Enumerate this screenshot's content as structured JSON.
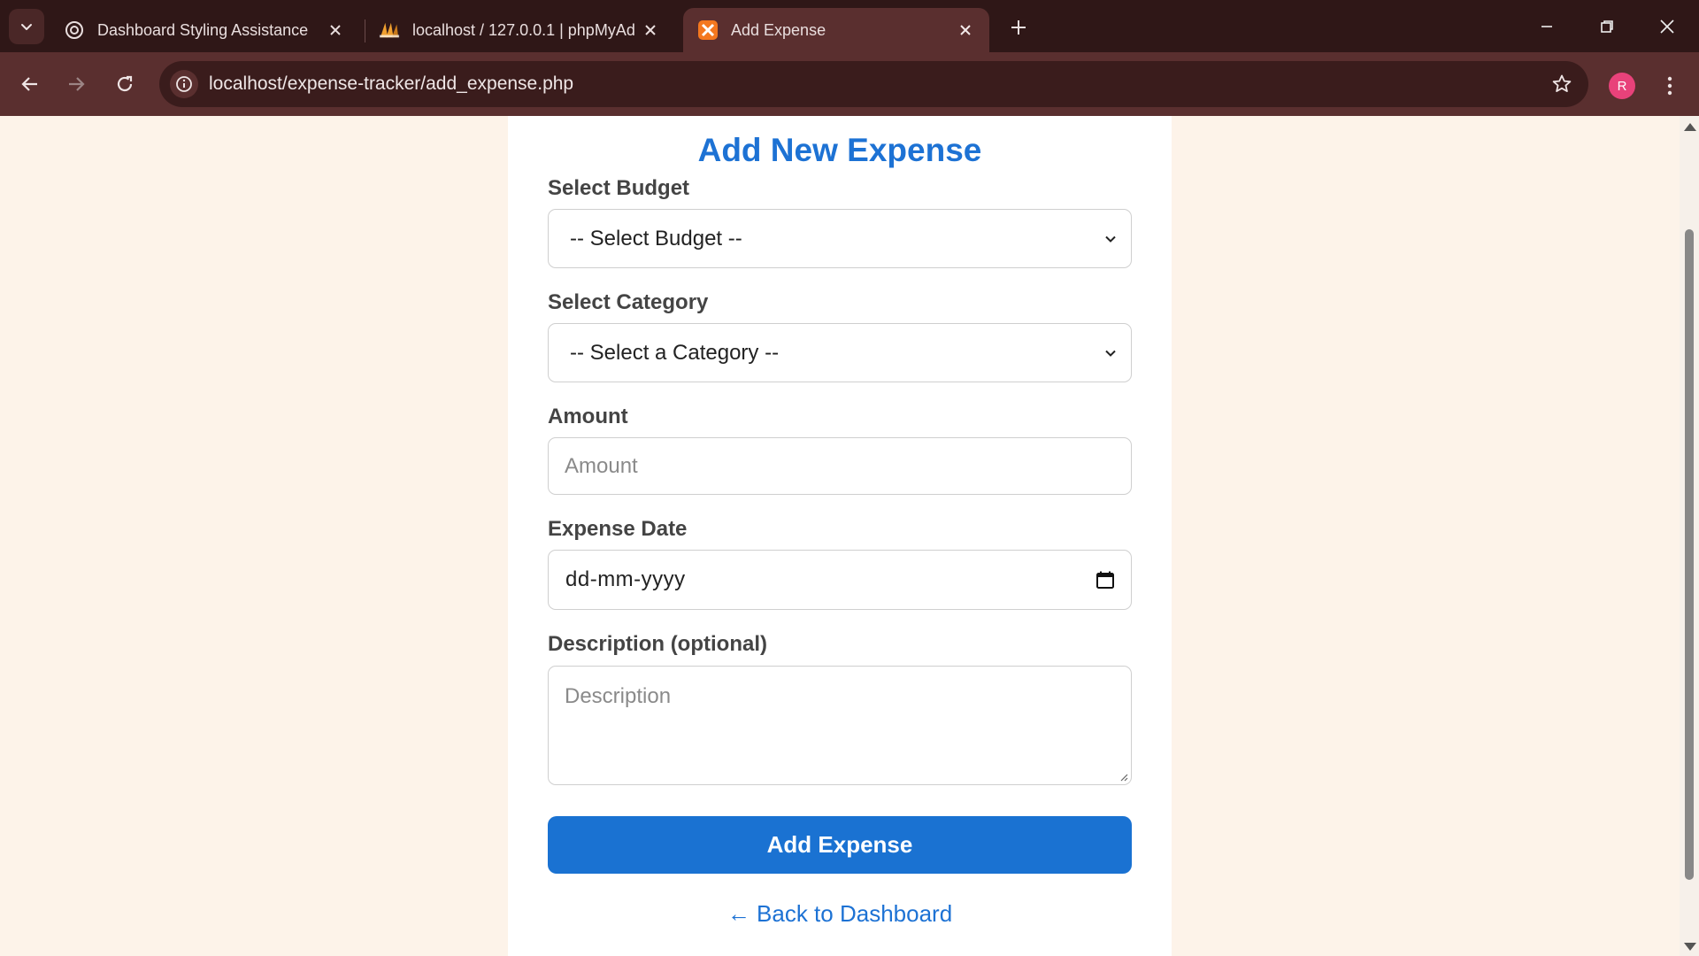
{
  "browser": {
    "tabs": [
      {
        "title": "Dashboard Styling Assistance",
        "favicon": "chatgpt-icon",
        "active": false
      },
      {
        "title": "localhost / 127.0.0.1 | phpMyAd",
        "favicon": "phpmyadmin-icon",
        "active": false
      },
      {
        "title": "Add Expense",
        "favicon": "xampp-icon",
        "active": true
      }
    ],
    "url": "localhost/expense-tracker/add_expense.php",
    "profile_initial": "R",
    "colors": {
      "tabstrip": "#2f1717",
      "toolbar": "#5a2f2f",
      "avatar": "#e8427a"
    }
  },
  "form": {
    "title": "Add New Expense",
    "budget": {
      "label": "Select Budget",
      "value": "-- Select Budget --"
    },
    "category": {
      "label": "Select Category",
      "value": "-- Select a Category --"
    },
    "amount": {
      "label": "Amount",
      "placeholder": "Amount"
    },
    "date": {
      "label": "Expense Date",
      "placeholder": "dd-mm-yyyy"
    },
    "description": {
      "label": "Description (optional)",
      "placeholder": "Description"
    },
    "submit_label": "Add Expense",
    "back_link": "← Back to Dashboard",
    "colors": {
      "accent": "#1a72d2",
      "page_bg": "#fdf3e9"
    }
  }
}
